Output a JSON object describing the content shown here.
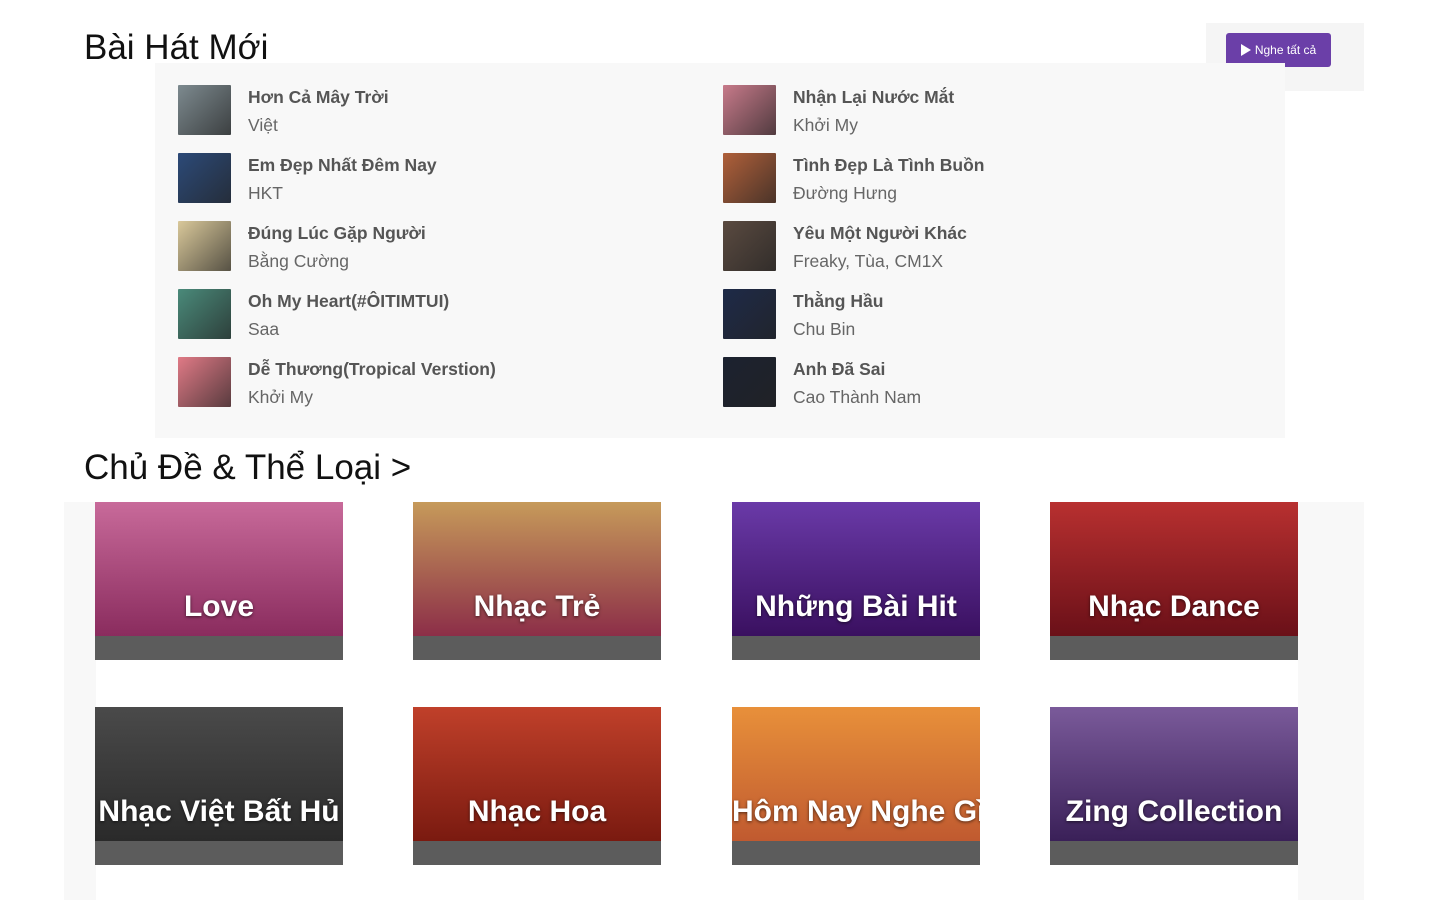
{
  "new_songs": {
    "title": "Bài Hát Mới",
    "play_all_label": "Nghe tất cả",
    "songs": [
      {
        "name": "Hơn Cả Mây Trời",
        "artist": "Việt",
        "thumb_color": "#7d8a8f"
      },
      {
        "name": "Nhận Lại Nước Mắt",
        "artist": "Khởi My",
        "thumb_color": "#c77a8a"
      },
      {
        "name": "Em Đẹp Nhất Đêm Nay",
        "artist": "HKT",
        "thumb_color": "#2c4a78"
      },
      {
        "name": "Tình Đẹp Là Tình Buồn",
        "artist": "Đường Hưng",
        "thumb_color": "#b0603a"
      },
      {
        "name": "Đúng Lúc Gặp Người",
        "artist": "Bằng Cường",
        "thumb_color": "#d9c89a"
      },
      {
        "name": "Yêu Một Người Khác",
        "artist": "Freaky, Tùa, CM1X",
        "thumb_color": "#5a4a40"
      },
      {
        "name": "Oh My Heart(#ÔITIMTUI)",
        "artist": "Saa",
        "thumb_color": "#4a8a7a"
      },
      {
        "name": "Thằng Hầu",
        "artist": "Chu Bin",
        "thumb_color": "#1e2a48"
      },
      {
        "name": "Dễ Thương(Tropical Verstion)",
        "artist": "Khởi My",
        "thumb_color": "#e07a86"
      },
      {
        "name": "Anh Đã Sai",
        "artist": "Cao Thành Nam",
        "thumb_color": "#1c2230"
      }
    ]
  },
  "genres": {
    "title": "Chủ Đề & Thể Loại >",
    "items": [
      {
        "label": "Love",
        "color_top": "#c86a9a",
        "color_bottom": "#8a2c5e"
      },
      {
        "label": "Nhạc Trẻ",
        "color_top": "#c69a5a",
        "color_bottom": "#8c2e48"
      },
      {
        "label": "Những Bài Hit",
        "color_top": "#6a3aa8",
        "color_bottom": "#3a1060"
      },
      {
        "label": "Nhạc Dance",
        "color_top": "#b83030",
        "color_bottom": "#6a1018"
      },
      {
        "label": "Nhạc Việt Bất Hủ",
        "color_top": "#4a4a4a",
        "color_bottom": "#2a2a2a"
      },
      {
        "label": "Nhạc Hoa",
        "color_top": "#c0402a",
        "color_bottom": "#7a1a10"
      },
      {
        "label": "Hôm Nay Nghe Gì",
        "color_top": "#e8903a",
        "color_bottom": "#c05a30"
      },
      {
        "label": "Zing Collection",
        "color_top": "#7a5a9a",
        "color_bottom": "#3a2058"
      }
    ]
  }
}
